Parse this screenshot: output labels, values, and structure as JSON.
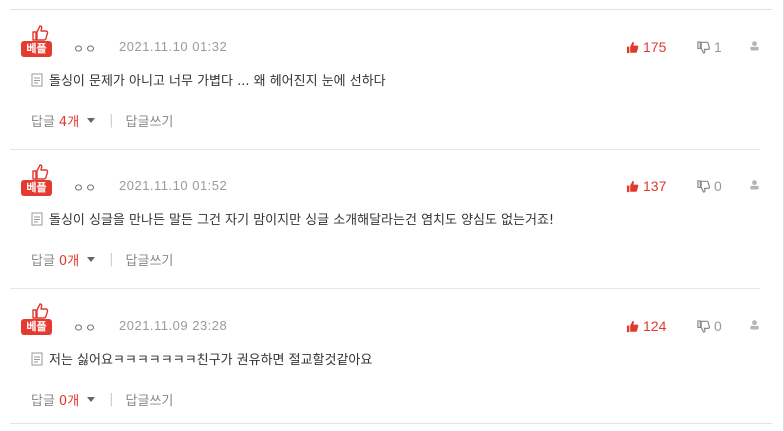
{
  "badge_label": "베플",
  "reply_label": "답글",
  "write_label": "답글쓰기",
  "accent": "#e2392f",
  "comments": [
    {
      "nickname": "ㅇㅇ",
      "date": "2021.11.10 01:32",
      "up": "175",
      "down": "1",
      "text": "돌싱이 문제가 아니고 너무 가볍다 ... 왜 헤어진지 눈에 선하다",
      "reply_count": "4개"
    },
    {
      "nickname": "ㅇㅇ",
      "date": "2021.11.10 01:52",
      "up": "137",
      "down": "0",
      "text": "돌싱이 싱글을 만나든 말든 그건 자기 맘이지만 싱글 소개해달라는건 염치도 양심도 없는거죠!",
      "reply_count": "0개"
    },
    {
      "nickname": "ㅇㅇ",
      "date": "2021.11.09 23:28",
      "up": "124",
      "down": "0",
      "text": "저는 싫어요ㅋㅋㅋㅋㅋㅋㅋ친구가 권유하면 절교할것같아요",
      "reply_count": "0개"
    }
  ]
}
